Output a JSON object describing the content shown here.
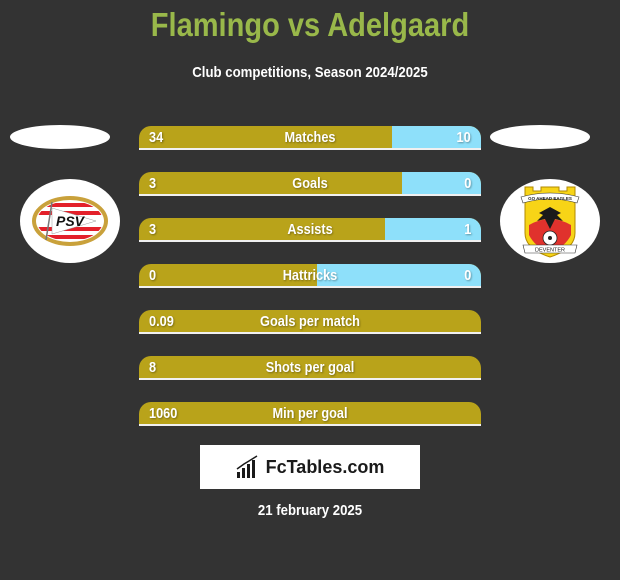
{
  "header": {
    "title": "Flamingo vs Adelgaard",
    "subtitle": "Club competitions, Season 2024/2025"
  },
  "teams": {
    "left": {
      "logo": "psv-crest-icon",
      "logo_text": "PSV"
    },
    "right": {
      "logo": "go-ahead-eagles-crest-icon",
      "logo_top_text": "GO AHEAD EAGLES",
      "logo_bottom_text": "DEVENTER"
    }
  },
  "colors": {
    "left_bar": "#b9a31a",
    "right_bar": "#8ee0fa",
    "title": "#99b84a",
    "background": "#333333"
  },
  "stats": [
    {
      "label": "Matches",
      "left": "34",
      "right": "10",
      "left_share": 0.74
    },
    {
      "label": "Goals",
      "left": "3",
      "right": "0",
      "left_share": 0.77
    },
    {
      "label": "Assists",
      "left": "3",
      "right": "1",
      "left_share": 0.72
    },
    {
      "label": "Hattricks",
      "left": "0",
      "right": "0",
      "left_share": 0.52
    },
    {
      "label": "Goals per match",
      "left": "0.09",
      "right": null,
      "left_share": 1.0
    },
    {
      "label": "Shots per goal",
      "left": "8",
      "right": null,
      "left_share": 1.0
    },
    {
      "label": "Min per goal",
      "left": "1060",
      "right": null,
      "left_share": 1.0
    }
  ],
  "footer": {
    "brand": "FcTables.com",
    "brand_icon": "bar-chart-icon",
    "date": "21 february 2025"
  }
}
